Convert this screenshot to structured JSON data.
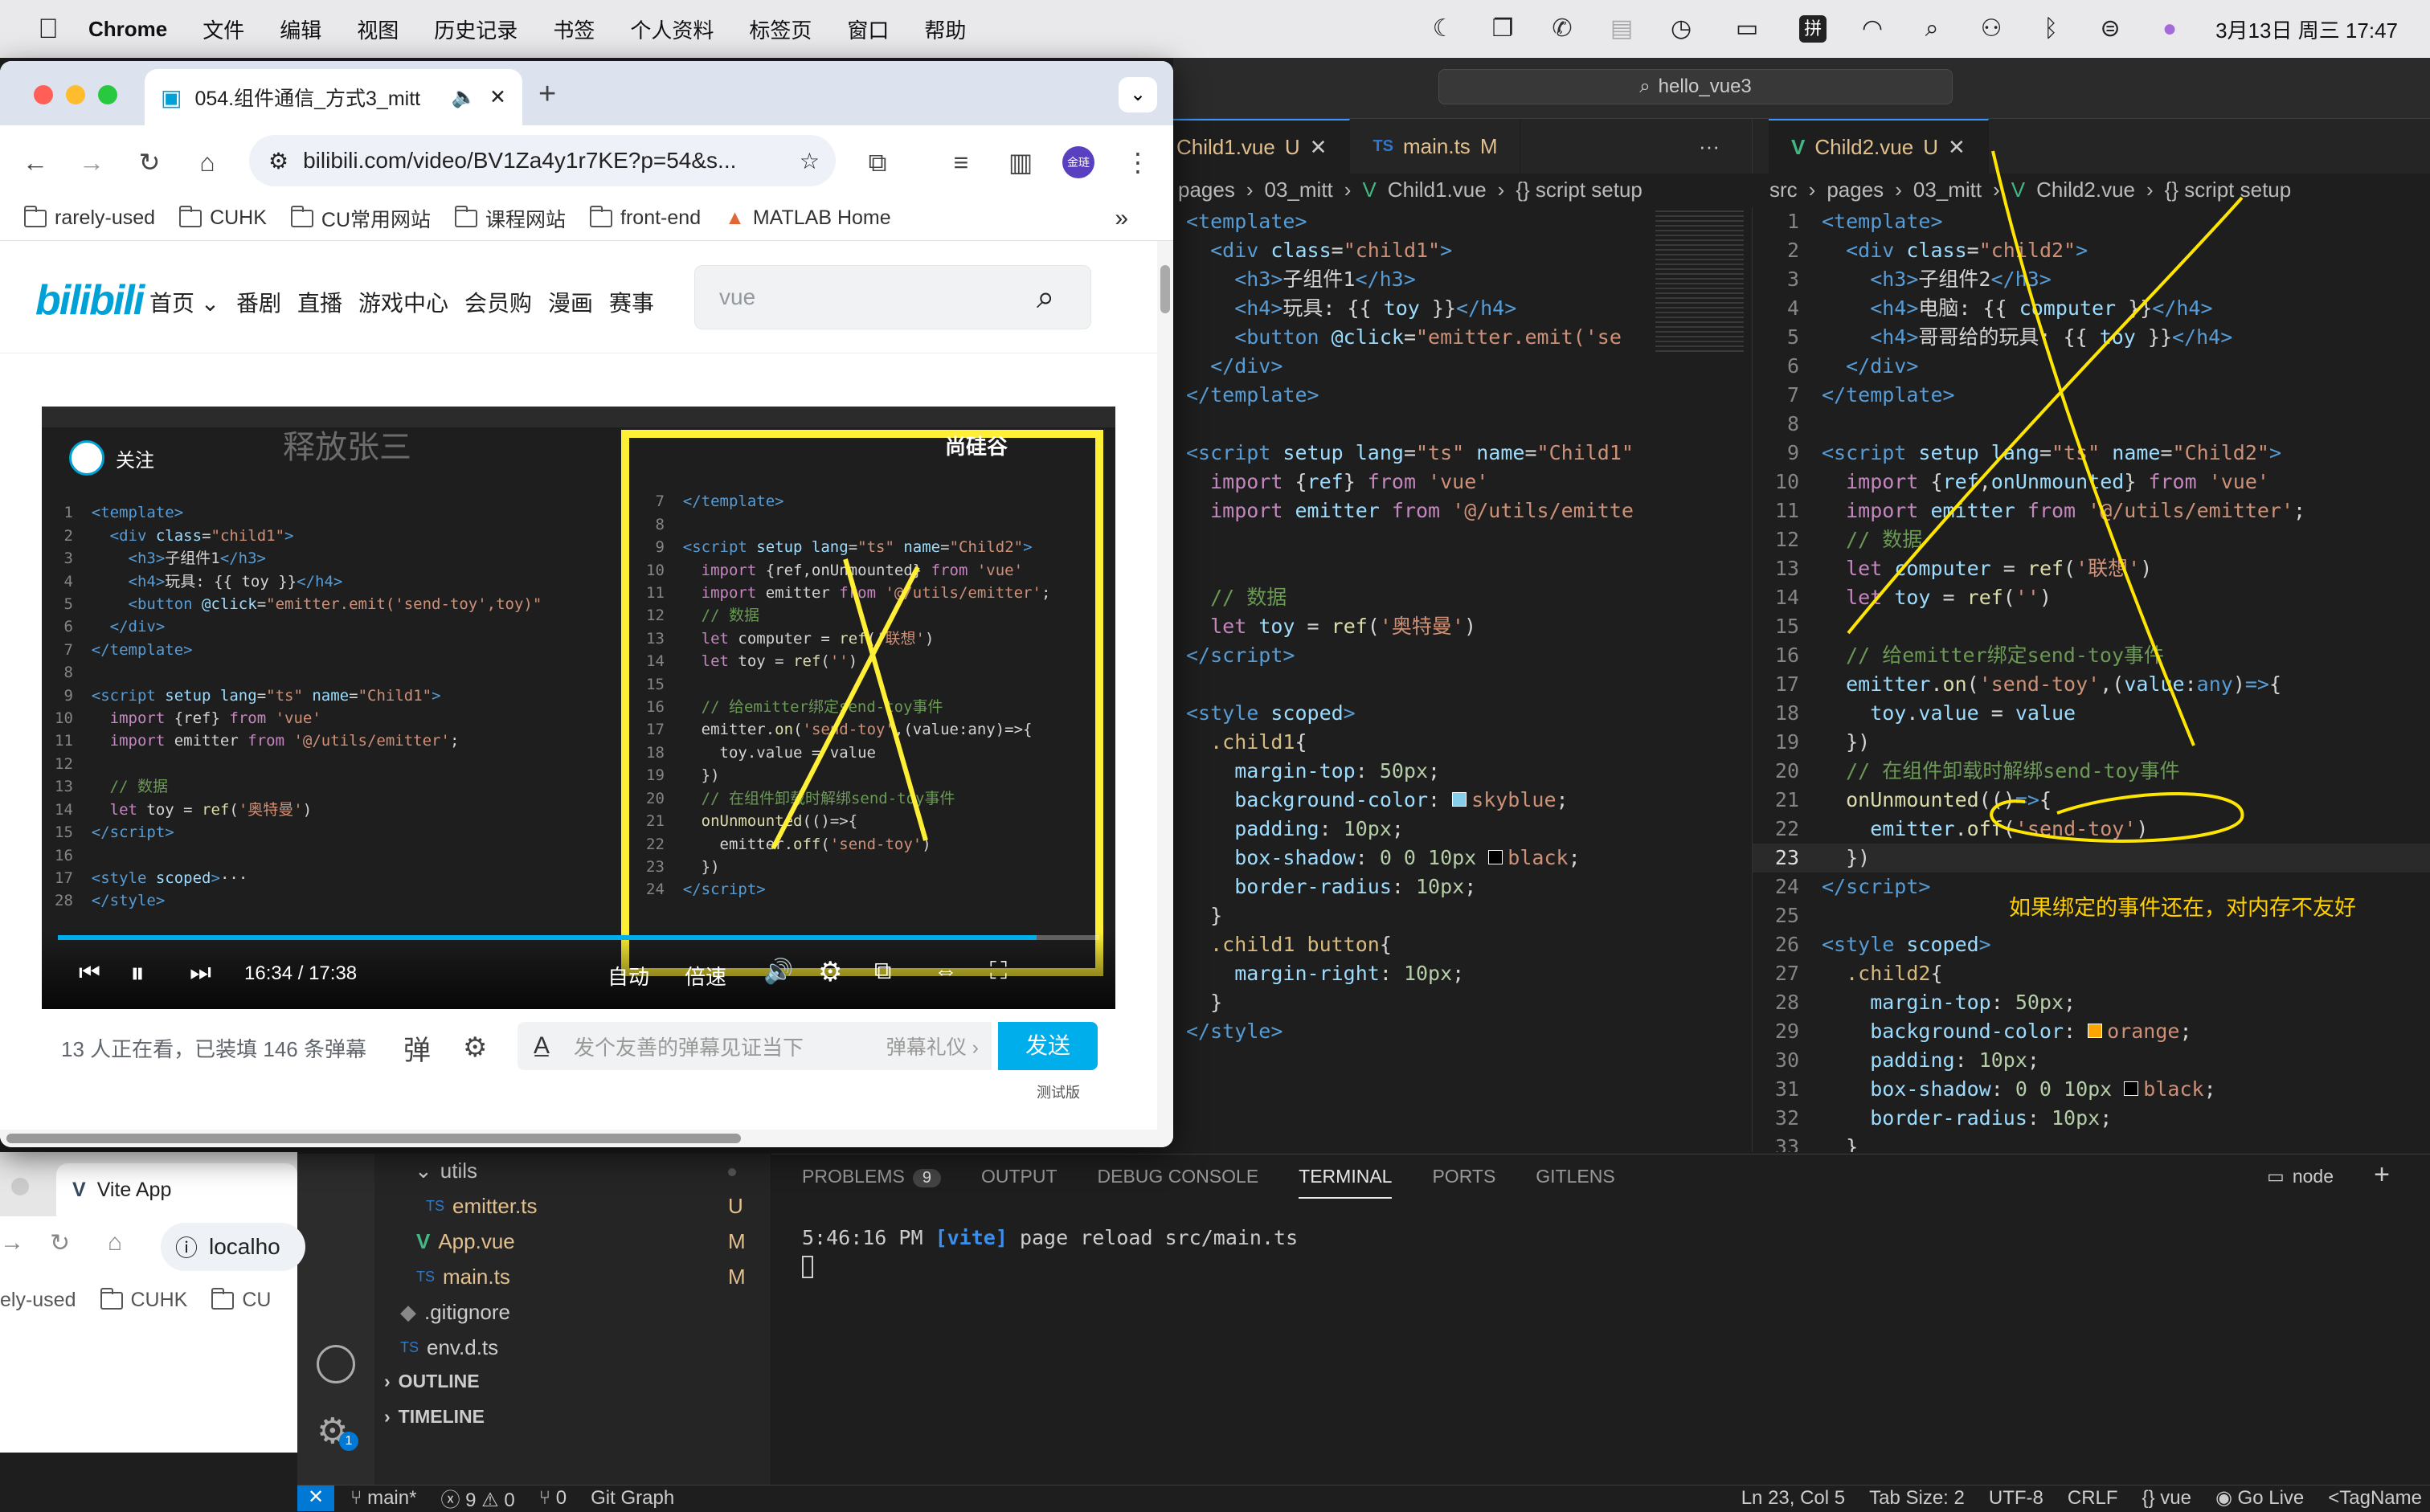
{
  "menubar": {
    "app": "Chrome",
    "items": [
      "文件",
      "编辑",
      "视图",
      "历史记录",
      "书签",
      "个人资料",
      "标签页",
      "窗口",
      "帮助"
    ],
    "input_method": "拼",
    "datetime": "3月13日 周三  17:47"
  },
  "vscode": {
    "search": "hello_vue3",
    "left_tabs": [
      {
        "name": "Child1.vue",
        "status": "U"
      },
      {
        "name": "main.ts",
        "status": "M"
      }
    ],
    "right_tab": {
      "name": "Child2.vue",
      "status": "U"
    },
    "left_crumbs": [
      "src",
      "pages",
      "03_mitt",
      "Child1.vue",
      "{} script setup"
    ],
    "right_crumbs": [
      "src",
      "pages",
      "03_mitt",
      "Child2.vue",
      "{} script setup"
    ],
    "annotation": "如果绑定的事件还在，对内存不友好",
    "panel_tabs": [
      "PROBLEMS",
      "OUTPUT",
      "DEBUG CONSOLE",
      "TERMINAL",
      "PORTS",
      "GITLENS"
    ],
    "problems_count": "9",
    "terminal_shell": "node",
    "terminal_line": {
      "time": "5:46:16 PM",
      "tag": "[vite]",
      "text": "page reload src/main.ts"
    },
    "explorer": {
      "utils": "utils",
      "files": [
        {
          "name": "emitter.ts",
          "status": "U",
          "type": "ts"
        },
        {
          "name": "App.vue",
          "status": "M",
          "type": "vue"
        },
        {
          "name": "main.ts",
          "status": "M",
          "type": "ts"
        },
        {
          "name": ".gitignore",
          "status": "",
          "type": "git"
        },
        {
          "name": "env.d.ts",
          "status": "",
          "type": "ts"
        }
      ],
      "outline": "OUTLINE",
      "timeline": "TIMELINE"
    },
    "status": {
      "branch": "main*",
      "errors": "9",
      "warnings": "0",
      "ports": "0",
      "git_graph": "Git Graph",
      "position": "Ln 23, Col 5",
      "tab_size": "Tab Size: 2",
      "encoding": "UTF-8",
      "eol": "CRLF",
      "lang": "vue",
      "live": "Go Live",
      "tag": "<TagName"
    }
  },
  "chrome": {
    "tab_title": "054.组件通信_方式3_mitt",
    "url": "bilibili.com/video/BV1Za4y1r7KE?p=54&s...",
    "profile": "金琏",
    "bookmarks": [
      "rarely-used",
      "CUHK",
      "CU常用网站",
      "课程网站",
      "front-end",
      "MATLAB Home"
    ],
    "bili_nav": [
      "首页",
      "番剧",
      "直播",
      "游戏中心",
      "会员购",
      "漫画",
      "赛事"
    ],
    "search_value": "vue",
    "video": {
      "uploader": "释放张三",
      "follow": "关注",
      "brand": "尚硅谷",
      "time_current": "16:34",
      "time_total": "17:38",
      "auto": "自动",
      "speed": "倍速"
    },
    "watching": "13 人正在看，已装填 146 条弹幕",
    "danmu_placeholder": "发个友善的弹幕见证当下",
    "danmu_etiquette": "弹幕礼仪",
    "send": "发送",
    "beta": "测试版"
  },
  "chrome2": {
    "tab_title": "Vite App",
    "url": "localho",
    "bookmarks": [
      "ely-used",
      "CUHK",
      "CU"
    ]
  }
}
